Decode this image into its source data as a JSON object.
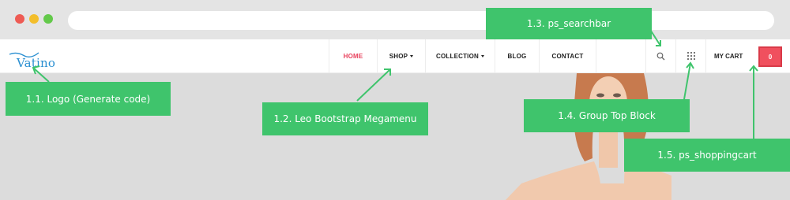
{
  "logo": {
    "text": "Vatino"
  },
  "nav": {
    "items": [
      {
        "label": "HOME",
        "active": true,
        "dropdown": false
      },
      {
        "label": "SHOP",
        "active": false,
        "dropdown": true
      },
      {
        "label": "COLLECTION",
        "active": false,
        "dropdown": true
      },
      {
        "label": "BLOG",
        "active": false,
        "dropdown": false
      },
      {
        "label": "CONTACT",
        "active": false,
        "dropdown": false
      }
    ]
  },
  "tools": {
    "search_icon": "search-icon",
    "group_icon": "grid-icon",
    "cart_label": "MY CART",
    "cart_count": "0"
  },
  "callouts": {
    "logo": "1.1. Logo (Generate code)",
    "megamenu": "1.2. Leo Bootstrap Megamenu",
    "searchbar": "1.3. ps_searchbar",
    "group_top": "1.4. Group Top Block",
    "cart": "1.5. ps_shoppingcart"
  },
  "colors": {
    "accent": "#e8405c",
    "callout": "#3fc46c",
    "cart_badge": "#f0505e",
    "logo": "#2a8fd1"
  }
}
